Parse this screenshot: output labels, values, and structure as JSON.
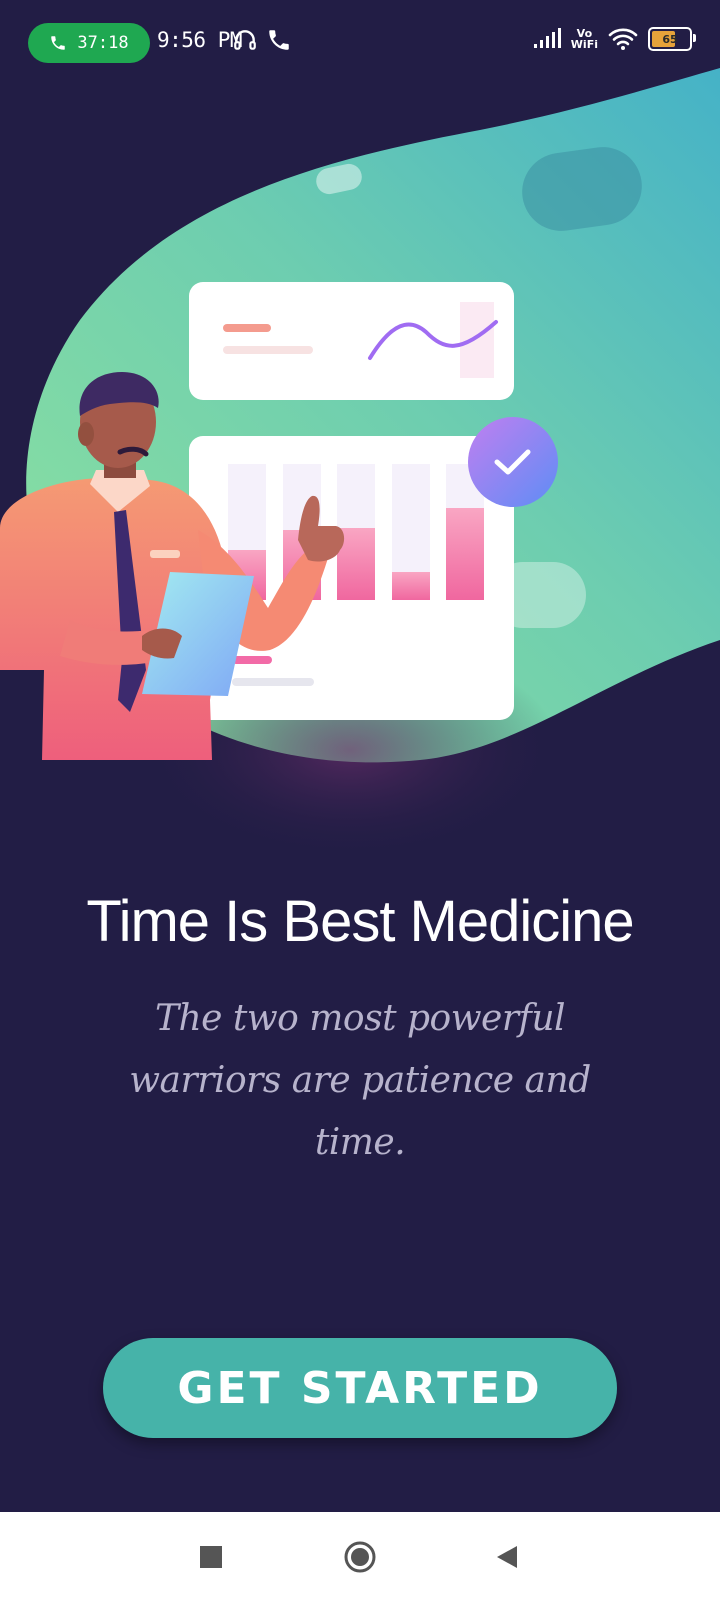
{
  "status_bar": {
    "call_timer": "37:18",
    "time": "9:56 PM",
    "network_label_top": "Vo",
    "network_label_bottom": "WiFi",
    "battery_level": "65",
    "icons": [
      "phone-icon",
      "headset-icon",
      "phone-icon",
      "signal-icon",
      "wifi-icon",
      "battery-icon"
    ]
  },
  "illustration": {
    "icon_name": "business-analytics-illustration",
    "accent_colors": {
      "blob_start": "#7fe0a2",
      "blob_end": "#46b3c9",
      "bar_pink": "#f26ba7",
      "check_badge": "#7d7ff2"
    }
  },
  "onboarding": {
    "title": "Time Is Best Medicine",
    "subtitle": "The two most powerful warriors are patience and time."
  },
  "cta": {
    "label": "GET STARTED",
    "color": "#46b3a9"
  },
  "nav_bar": {
    "icons": [
      "recents-square-icon",
      "home-circle-icon",
      "back-triangle-icon"
    ]
  },
  "theme": {
    "background": "#221d45",
    "text_primary": "#ffffff",
    "text_secondary": "#b7b3cc"
  }
}
